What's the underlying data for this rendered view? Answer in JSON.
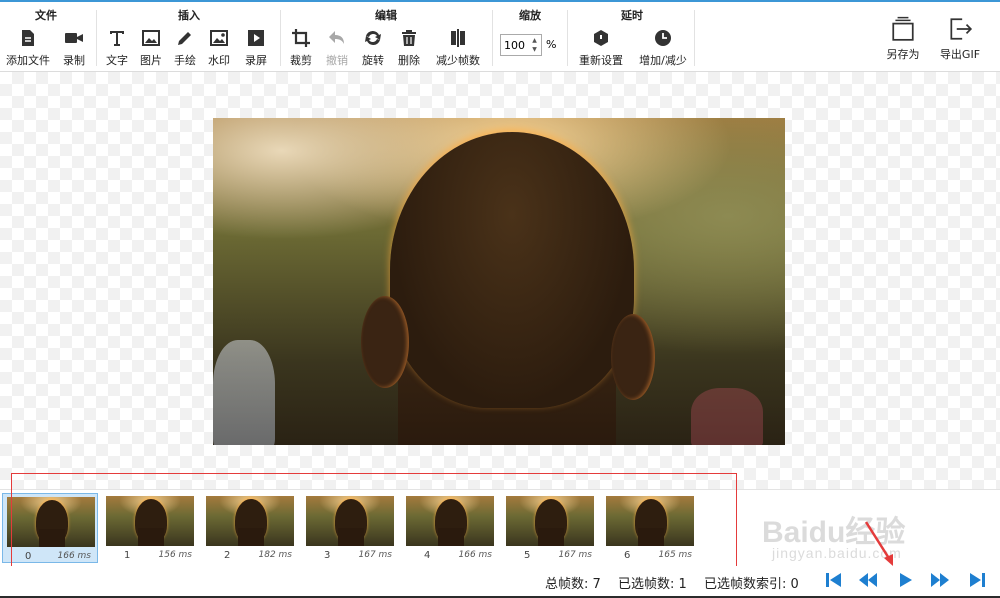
{
  "toolbar": {
    "groups": [
      {
        "title": "文件",
        "buttons": [
          {
            "label": "添加文件",
            "icon": "file-icon"
          },
          {
            "label": "录制",
            "icon": "camera-icon"
          }
        ]
      },
      {
        "title": "插入",
        "buttons": [
          {
            "label": "文字",
            "icon": "text-icon"
          },
          {
            "label": "图片",
            "icon": "image-icon"
          },
          {
            "label": "手绘",
            "icon": "pencil-icon"
          },
          {
            "label": "水印",
            "icon": "watermark-icon"
          },
          {
            "label": "录屏",
            "icon": "screen-record-icon"
          }
        ]
      },
      {
        "title": "编辑",
        "buttons": [
          {
            "label": "裁剪",
            "icon": "crop-icon"
          },
          {
            "label": "撤销",
            "icon": "undo-icon",
            "disabled": true
          },
          {
            "label": "旋转",
            "icon": "rotate-icon"
          },
          {
            "label": "删除",
            "icon": "trash-icon"
          },
          {
            "label": "减少帧数",
            "icon": "reduce-frames-icon"
          }
        ]
      },
      {
        "title": "缩放"
      },
      {
        "title": "延时",
        "buttons": [
          {
            "label": "重新设置",
            "icon": "reset-icon"
          },
          {
            "label": "增加/减少",
            "icon": "clock-icon"
          }
        ]
      }
    ],
    "zoom": {
      "value": "100",
      "unit": "%"
    },
    "save_as": {
      "label": "另存为",
      "icon": "save-as-icon"
    },
    "export": {
      "label": "导出GIF",
      "icon": "export-icon"
    }
  },
  "frames": [
    {
      "index": "0",
      "duration": "166 ms",
      "selected": true
    },
    {
      "index": "1",
      "duration": "156 ms"
    },
    {
      "index": "2",
      "duration": "182 ms"
    },
    {
      "index": "3",
      "duration": "167 ms"
    },
    {
      "index": "4",
      "duration": "166 ms"
    },
    {
      "index": "5",
      "duration": "167 ms"
    },
    {
      "index": "6",
      "duration": "165 ms"
    }
  ],
  "status": {
    "total_frames": "总帧数: 7",
    "selected_frames": "已选帧数: 1",
    "selected_index": "已选帧数索引: 0"
  },
  "watermark": {
    "brand": "Baidu经验",
    "url": "jingyan.baidu.com"
  },
  "colors": {
    "accent": "#1e7fd0",
    "annotation": "#e43b3b"
  }
}
